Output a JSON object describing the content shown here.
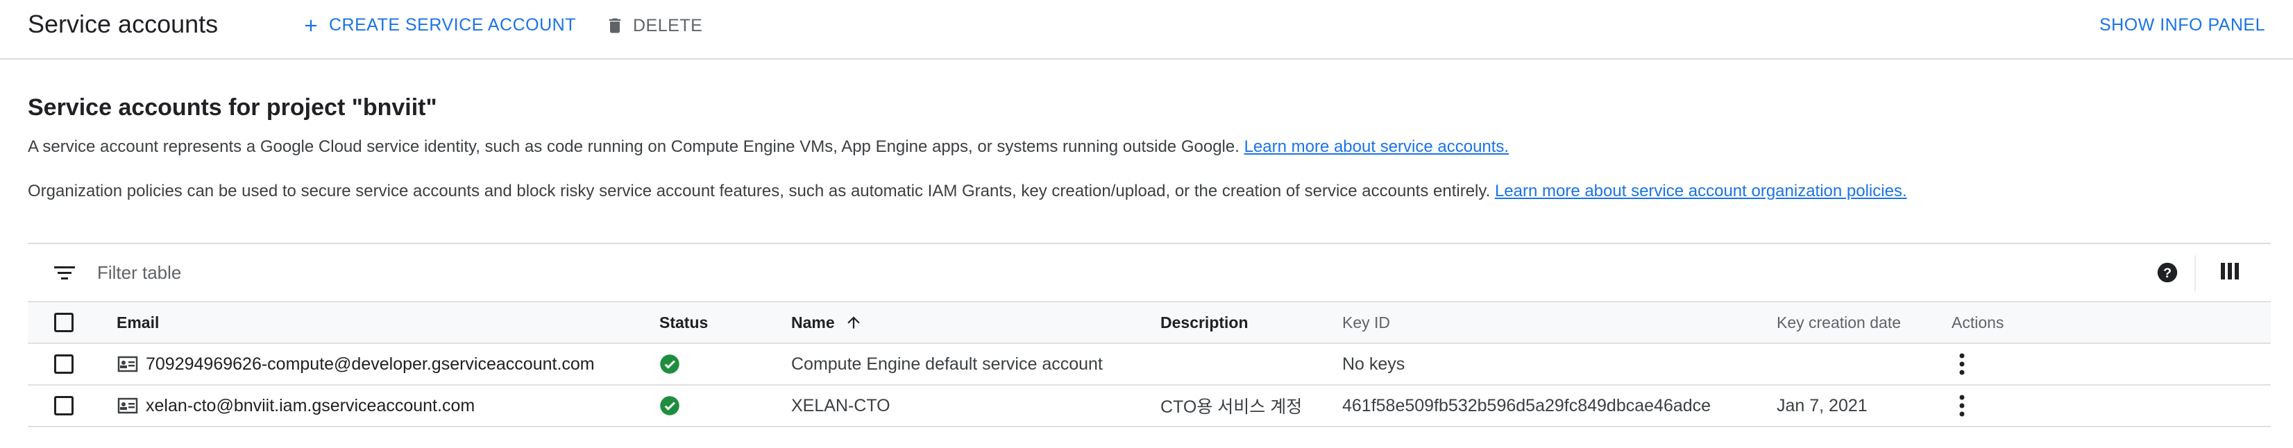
{
  "header": {
    "title": "Service accounts",
    "create_label": "CREATE SERVICE ACCOUNT",
    "delete_label": "DELETE",
    "info_panel_label": "SHOW INFO PANEL"
  },
  "section": {
    "title": "Service accounts for project \"bnviit\"",
    "desc1_text": "A service account represents a Google Cloud service identity, such as code running on Compute Engine VMs, App Engine apps, or systems running outside Google. ",
    "desc1_link": "Learn more about service accounts.",
    "desc2_text": "Organization policies can be used to secure service accounts and block risky service account features, such as automatic IAM Grants, key creation/upload, or the creation of service accounts entirely. ",
    "desc2_link": "Learn more about service account organization policies."
  },
  "filter": {
    "placeholder": "Filter table"
  },
  "table": {
    "columns": {
      "email": "Email",
      "status": "Status",
      "name": "Name",
      "description": "Description",
      "key_id": "Key ID",
      "key_date": "Key creation date",
      "actions": "Actions"
    },
    "rows": [
      {
        "email": "709294969626-compute@developer.gserviceaccount.com",
        "status": "enabled",
        "name": "Compute Engine default service account",
        "description": "",
        "key_id": "No keys",
        "key_date": ""
      },
      {
        "email": "xelan-cto@bnviit.iam.gserviceaccount.com",
        "status": "enabled",
        "name": "XELAN-CTO",
        "description": "CTO용 서비스 계정",
        "key_id": "461f58e509fb532b596d5a29fc849dbcae46adce",
        "key_date": "Jan 7, 2021"
      }
    ]
  },
  "colors": {
    "accent": "#1a73e8",
    "success": "#1e8e3e",
    "muted": "#5f6368"
  },
  "icons": [
    "plus-icon",
    "trash-icon",
    "filter-icon",
    "help-icon",
    "columns-icon",
    "service-account-icon",
    "check-circle-icon",
    "arrow-up-icon",
    "more-vert-icon"
  ]
}
